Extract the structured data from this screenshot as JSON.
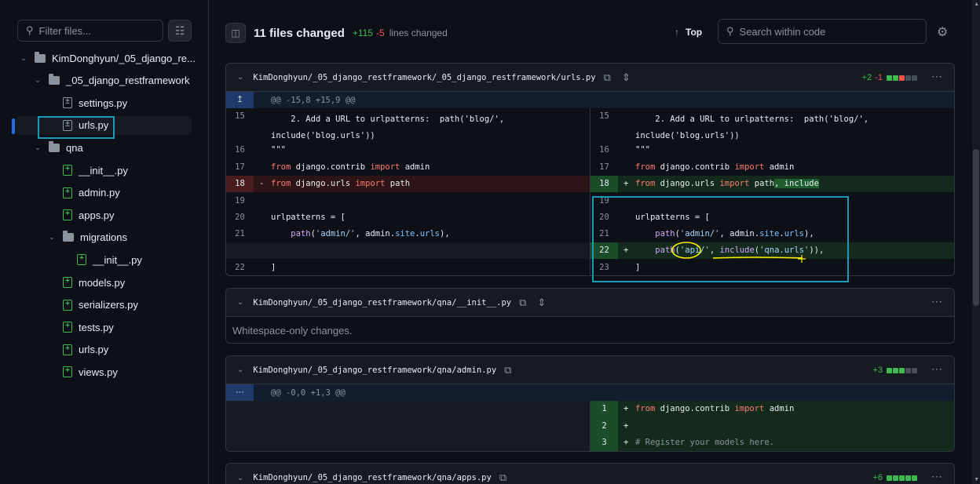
{
  "sidebar": {
    "filter_placeholder": "Filter files...",
    "tree": [
      {
        "label": "KimDonghyun/_05_django_re...",
        "kind": "folder",
        "depth": 0,
        "expanded": true
      },
      {
        "label": "_05_django_restframework",
        "kind": "folder",
        "depth": 1,
        "expanded": true
      },
      {
        "label": "settings.py",
        "kind": "file-modified",
        "depth": 2
      },
      {
        "label": "urls.py",
        "kind": "file-modified",
        "depth": 2,
        "selected": true
      },
      {
        "label": "qna",
        "kind": "folder",
        "depth": 1,
        "expanded": true
      },
      {
        "label": "__init__.py",
        "kind": "file-added",
        "depth": 2
      },
      {
        "label": "admin.py",
        "kind": "file-added",
        "depth": 2
      },
      {
        "label": "apps.py",
        "kind": "file-added",
        "depth": 2
      },
      {
        "label": "migrations",
        "kind": "folder",
        "depth": 2,
        "expanded": true
      },
      {
        "label": "__init__.py",
        "kind": "file-added",
        "depth": 3
      },
      {
        "label": "models.py",
        "kind": "file-added",
        "depth": 2
      },
      {
        "label": "serializers.py",
        "kind": "file-added",
        "depth": 2
      },
      {
        "label": "tests.py",
        "kind": "file-added",
        "depth": 2
      },
      {
        "label": "urls.py",
        "kind": "file-added",
        "depth": 2
      },
      {
        "label": "views.py",
        "kind": "file-added",
        "depth": 2
      }
    ]
  },
  "header": {
    "files_changed": "11 files changed",
    "additions": "+115",
    "deletions": "-5",
    "lines_changed_label": "lines changed",
    "top_label": "Top",
    "search_placeholder": "Search within code"
  },
  "files": {
    "urls": {
      "name": "KimDonghyun/_05_django_restframework/_05_django_restframework/urls.py",
      "additions": "+2",
      "deletions": "-1",
      "hunk": "@@ -15,8 +15,9 @@"
    },
    "qna_init": {
      "name": "KimDonghyun/_05_django_restframework/qna/__init__.py",
      "note": "Whitespace-only changes."
    },
    "qna_admin": {
      "name": "KimDonghyun/_05_django_restframework/qna/admin.py",
      "additions": "+3",
      "hunk": "@@ -0,0 +1,3 @@"
    },
    "qna_apps": {
      "name": "KimDonghyun/_05_django_restframework/qna/apps.py",
      "additions": "+6"
    }
  },
  "colors": {
    "accent_blue": "#1f6feb",
    "annotation_cyan": "#1a9bb8",
    "annotation_yellow": "#ffee00",
    "add_green": "#3fb950",
    "del_red": "#f85149"
  }
}
